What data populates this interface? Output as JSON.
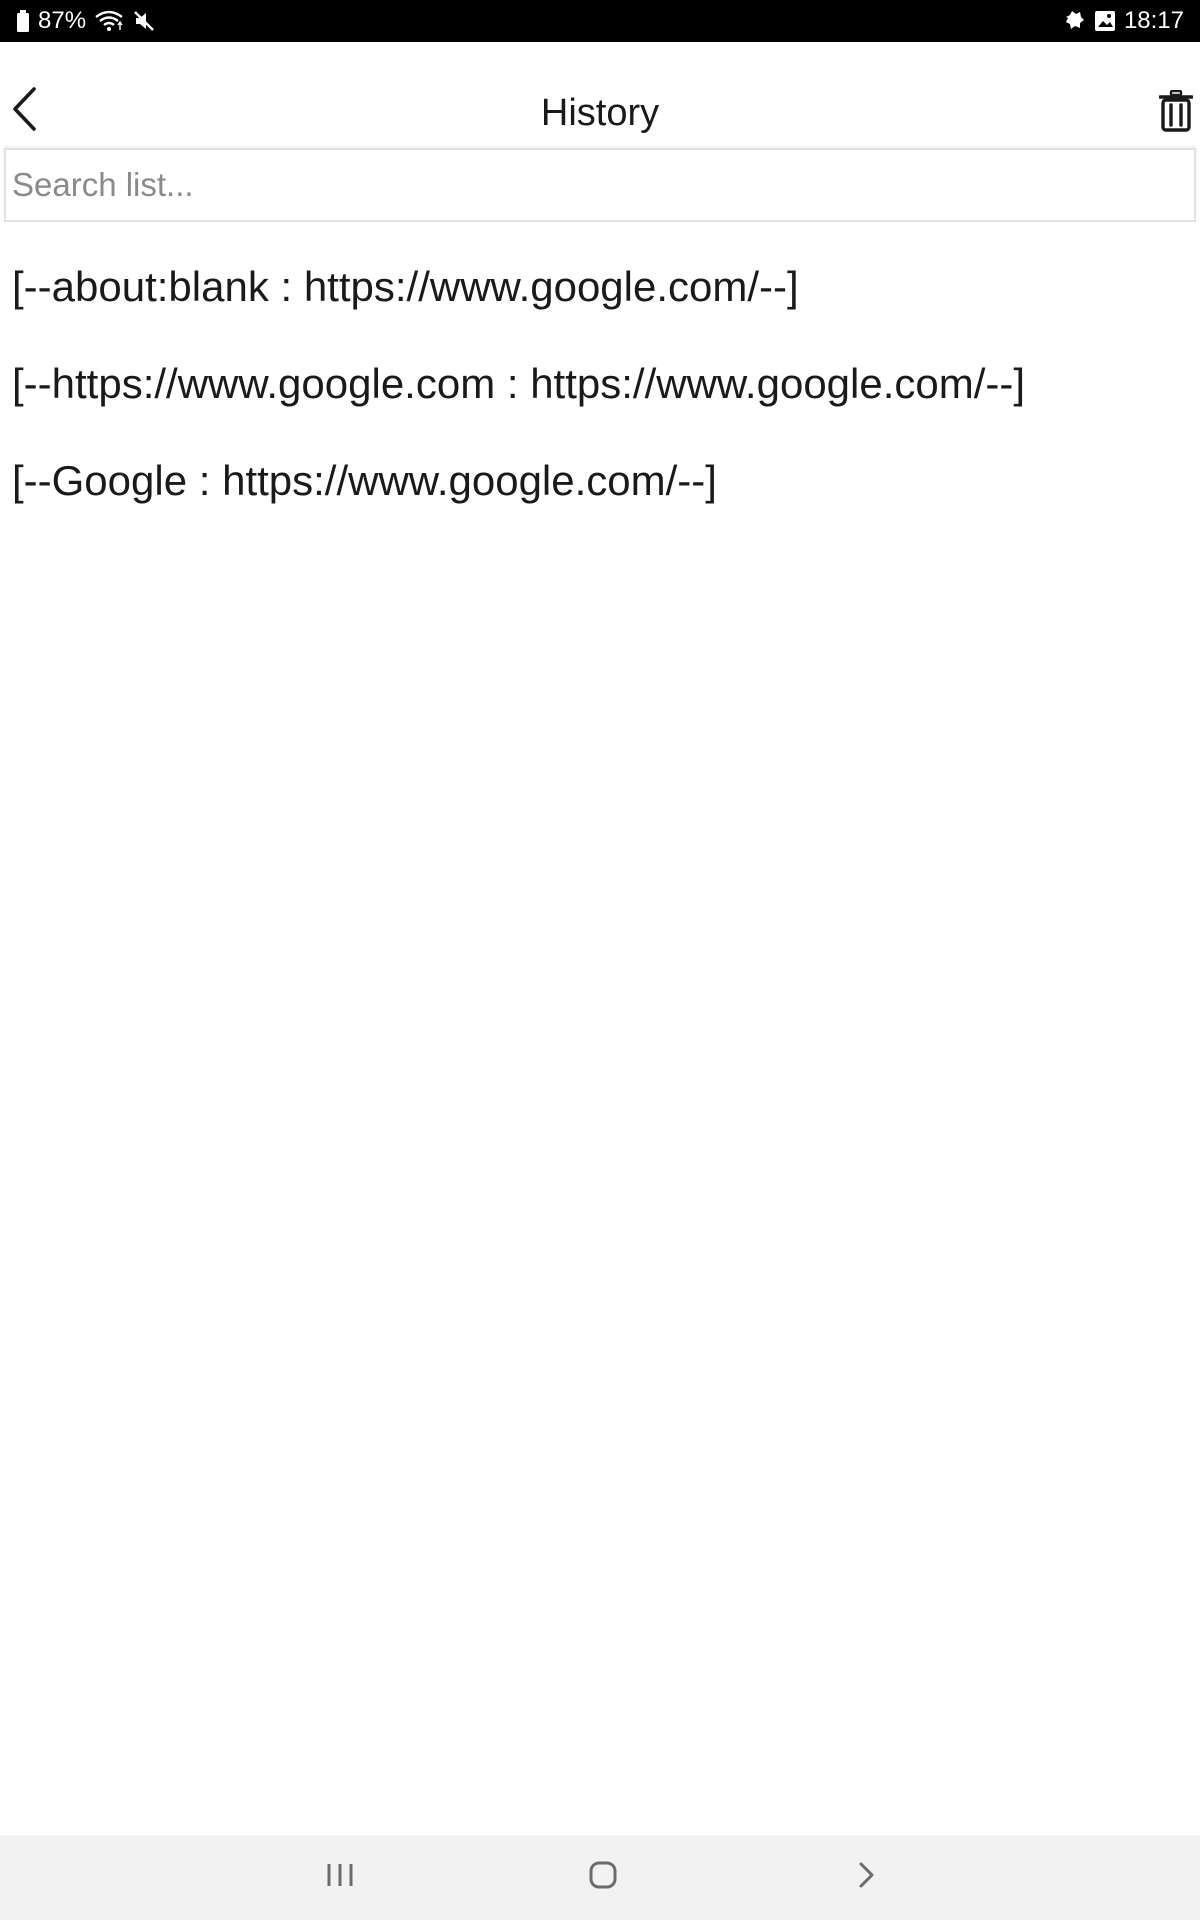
{
  "status_bar": {
    "battery": "87%",
    "time": "18:17",
    "icons": [
      "battery-icon",
      "wifi-icon",
      "mute-icon",
      "notification-icon",
      "image-icon"
    ]
  },
  "header": {
    "title": "History",
    "back_icon": "chevron-left-icon",
    "delete_icon": "trash-icon"
  },
  "search": {
    "placeholder": "Search list...",
    "value": ""
  },
  "history": {
    "items": [
      {
        "text": "[--about:blank : https://www.google.com/--]"
      },
      {
        "text": "[--https://www.google.com : https://www.google.com/--]"
      },
      {
        "text": "[--Google : https://www.google.com/--]"
      }
    ]
  },
  "nav_bar": {
    "icons": [
      "recents-icon",
      "home-icon",
      "back-icon"
    ]
  },
  "colors": {
    "status_bar_bg": "#000000",
    "background": "#ffffff",
    "nav_bar_bg": "#f2f2f2",
    "text": "#1a1a1a",
    "placeholder": "#8a8a8a"
  }
}
